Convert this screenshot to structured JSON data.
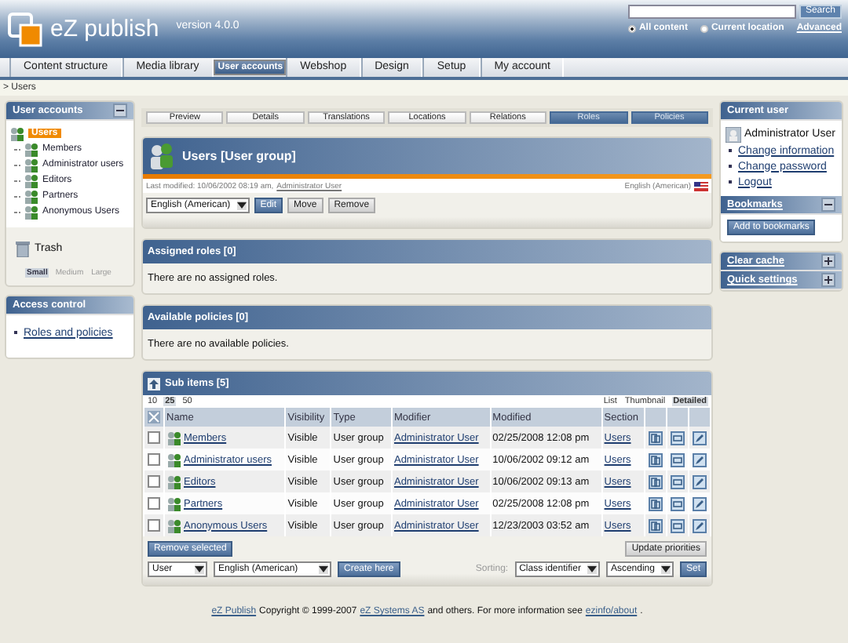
{
  "header": {
    "logo": "eZ publish",
    "version": "version 4.0.0",
    "search": {
      "button": "Search",
      "advanced": "Advanced",
      "scopes": [
        {
          "label": "All content",
          "selected": true
        },
        {
          "label": "Current location",
          "selected": false
        }
      ]
    }
  },
  "main_tabs": [
    {
      "label": "Content structure",
      "selected": false
    },
    {
      "label": "Media library",
      "selected": false
    },
    {
      "label": "User accounts",
      "selected": true
    },
    {
      "label": "Webshop",
      "selected": false
    },
    {
      "label": "Design",
      "selected": false
    },
    {
      "label": "Setup",
      "selected": false
    },
    {
      "label": "My account",
      "selected": false
    }
  ],
  "breadcrumb": "> Users",
  "left": {
    "user_accounts": {
      "title": "User accounts",
      "tree": {
        "label": "Users",
        "selected": true,
        "children": [
          {
            "label": "Members",
            "selected": false
          },
          {
            "label": "Administrator users",
            "selected": false
          },
          {
            "label": "Editors",
            "selected": false
          },
          {
            "label": "Partners",
            "selected": false
          },
          {
            "label": "Anonymous Users",
            "selected": false
          }
        ]
      }
    },
    "trash": "Trash",
    "sizes": [
      {
        "label": "Small",
        "selected": true
      },
      {
        "label": "Medium",
        "selected": false
      },
      {
        "label": "Large",
        "selected": false
      }
    ],
    "access_control": {
      "title": "Access control",
      "links": [
        "Roles and policies"
      ]
    }
  },
  "view_tabs": [
    {
      "label": "Preview",
      "selected": false
    },
    {
      "label": "Details",
      "selected": false
    },
    {
      "label": "Translations",
      "selected": false
    },
    {
      "label": "Locations",
      "selected": false
    },
    {
      "label": "Relations",
      "selected": false
    },
    {
      "label": "Roles",
      "selected": true
    },
    {
      "label": "Policies",
      "selected": true
    }
  ],
  "object": {
    "title": "Users [User group]",
    "last_modified": "Last modified: 10/06/2002 08:19 am,",
    "modifier": "Administrator User",
    "language": "English (American)",
    "language_select": "English (American)",
    "buttons": [
      {
        "label": "Edit",
        "kind": "primary"
      },
      {
        "label": "Move",
        "kind": "normal"
      },
      {
        "label": "Remove",
        "kind": "normal"
      }
    ]
  },
  "assigned_roles": {
    "title": "Assigned roles [0]",
    "message": "There are no assigned roles."
  },
  "available_policies": {
    "title": "Available policies [0]",
    "message": "There are no available policies."
  },
  "sub_items": {
    "title": "Sub items [5]",
    "page_sizes": [
      {
        "label": "10",
        "selected": false
      },
      {
        "label": "25",
        "selected": true
      },
      {
        "label": "50",
        "selected": false
      }
    ],
    "view_modes": [
      {
        "label": "List",
        "selected": false
      },
      {
        "label": "Thumbnail",
        "selected": false
      },
      {
        "label": "Detailed",
        "selected": true
      }
    ],
    "columns": [
      "Name",
      "Visibility",
      "Type",
      "Modifier",
      "Modified",
      "Section"
    ],
    "rows": [
      {
        "name": "Members",
        "visibility": "Visible",
        "type": "User group",
        "modifier": "Administrator User",
        "modified": "02/25/2008 12:08 pm",
        "section": "Users",
        "checked": false
      },
      {
        "name": "Administrator users",
        "visibility": "Visible",
        "type": "User group",
        "modifier": "Administrator User",
        "modified": "10/06/2002 09:12 am",
        "section": "Users",
        "checked": false
      },
      {
        "name": "Editors",
        "visibility": "Visible",
        "type": "User group",
        "modifier": "Administrator User",
        "modified": "10/06/2002 09:13 am",
        "section": "Users",
        "checked": false
      },
      {
        "name": "Partners",
        "visibility": "Visible",
        "type": "User group",
        "modifier": "Administrator User",
        "modified": "02/25/2008 12:08 pm",
        "section": "Users",
        "checked": false
      },
      {
        "name": "Anonymous Users",
        "visibility": "Visible",
        "type": "User group",
        "modifier": "Administrator User",
        "modified": "12/23/2003 03:52 am",
        "section": "Users",
        "checked": false
      }
    ],
    "remove_button": "Remove selected",
    "update_button": "Update priorities",
    "class_select": "User",
    "language_select": "English (American)",
    "create_button": "Create here",
    "sorting_label": "Sorting:",
    "sort_field": "Class identifier",
    "sort_order": "Ascending",
    "set_button": "Set"
  },
  "right": {
    "current_user": {
      "title": "Current user",
      "name": "Administrator User",
      "links": [
        "Change information",
        "Change password",
        "Logout"
      ]
    },
    "bookmarks": {
      "title": "Bookmarks",
      "expanded": true,
      "add_button": "Add to bookmarks"
    },
    "clear_cache": {
      "title": "Clear cache",
      "expanded": false
    },
    "quick_settings": {
      "title": "Quick settings",
      "expanded": false
    }
  },
  "footer": [
    {
      "text": "eZ Publish",
      "link": true
    },
    {
      "text": "Copyright © 1999-2007",
      "link": false
    },
    {
      "text": "eZ Systems AS",
      "link": true
    },
    {
      "text": "and others. For more information see",
      "link": false
    },
    {
      "text": "ezinfo/about",
      "link": true
    },
    {
      "text": ".",
      "link": false
    }
  ]
}
